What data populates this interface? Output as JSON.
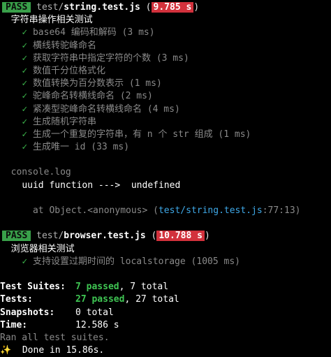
{
  "colors": {
    "background": "#000000",
    "pass_badge": "#39a04a",
    "slow_time_badge": "#d2313c",
    "check": "#3bb34a",
    "passed_text": "#3fc653",
    "link": "#3fa9e8"
  },
  "suites": [
    {
      "status": "PASS",
      "path_dir": "test/",
      "file": "string.test.js",
      "time": "9.785 s",
      "describe": "字符串操作相关测试",
      "tests": [
        {
          "name": "base64 编码和解码",
          "time": "(3 ms)"
        },
        {
          "name": "横线转驼峰命名",
          "time": ""
        },
        {
          "name": "获取字符串中指定字符的个数",
          "time": "(3 ms)"
        },
        {
          "name": "数值千分位格式化",
          "time": ""
        },
        {
          "name": "数值转换为百分数表示",
          "time": "(1 ms)"
        },
        {
          "name": "驼峰命名转横线命名",
          "time": "(2 ms)"
        },
        {
          "name": "紧凑型驼峰命名转横线命名",
          "time": "(4 ms)"
        },
        {
          "name": "生成随机字符串",
          "time": ""
        },
        {
          "name": "生成一个重复的字符串，有 n 个 str 组成",
          "time": "(1 ms)"
        },
        {
          "name": "生成唯一 id",
          "time": "(33 ms)"
        }
      ],
      "console": {
        "header": "console.log",
        "message": "uuid function --->  undefined",
        "at_prefix": "at Object.<anonymous> (",
        "at_file": "test/string.test.js",
        "at_loc": ":77:13)"
      }
    },
    {
      "status": "PASS",
      "path_dir": "test/",
      "file": "browser.test.js",
      "time": "10.788 s",
      "describe": "浏览器相关测试",
      "tests": [
        {
          "name": "支持设置过期时间的 localstorage",
          "time": "(1005 ms)"
        }
      ]
    }
  ],
  "summary": {
    "suites_label": "Test Suites:",
    "suites_passed": "7 passed",
    "suites_total": ", 7 total",
    "tests_label": "Tests:",
    "tests_passed": "27 passed",
    "tests_total": ", 27 total",
    "snapshots_label": "Snapshots:",
    "snapshots_value": "0 total",
    "time_label": "Time:",
    "time_value": "12.586 s",
    "ran_all": "Ran all test suites.",
    "done_icon": "✨",
    "done_text": "Done in 15.86s."
  },
  "check_glyph": "✓"
}
